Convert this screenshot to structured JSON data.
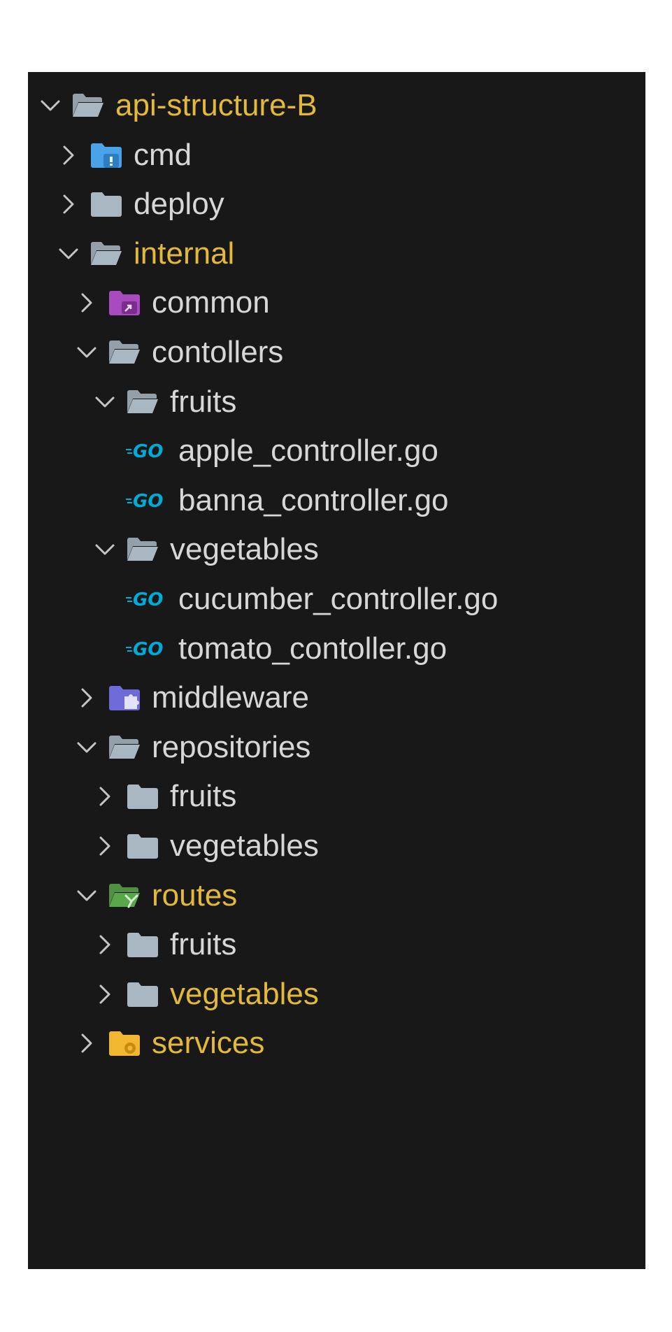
{
  "explorer": {
    "items": [
      {
        "label": "api-structure-B",
        "kind": "folder-open",
        "depth": 0,
        "expanded": true,
        "modified": true,
        "icon": "folder-open-icon"
      },
      {
        "label": "cmd",
        "kind": "folder",
        "depth": 1,
        "expanded": false,
        "modified": false,
        "icon": "folder-cmd-icon"
      },
      {
        "label": "deploy",
        "kind": "folder",
        "depth": 1,
        "expanded": false,
        "modified": false,
        "icon": "folder-icon"
      },
      {
        "label": "internal",
        "kind": "folder-open",
        "depth": 1,
        "expanded": true,
        "modified": true,
        "icon": "folder-open-icon"
      },
      {
        "label": "common",
        "kind": "folder",
        "depth": 2,
        "expanded": false,
        "modified": false,
        "icon": "folder-common-icon"
      },
      {
        "label": "contollers",
        "kind": "folder-open",
        "depth": 2,
        "expanded": true,
        "modified": false,
        "icon": "folder-open-icon"
      },
      {
        "label": "fruits",
        "kind": "folder-open",
        "depth": 3,
        "expanded": true,
        "modified": false,
        "icon": "folder-open-icon"
      },
      {
        "label": "apple_controller.go",
        "kind": "file-go",
        "depth": 4,
        "modified": false,
        "icon": "go-file-icon"
      },
      {
        "label": "banna_controller.go",
        "kind": "file-go",
        "depth": 4,
        "modified": false,
        "icon": "go-file-icon"
      },
      {
        "label": "vegetables",
        "kind": "folder-open",
        "depth": 3,
        "expanded": true,
        "modified": false,
        "icon": "folder-open-icon"
      },
      {
        "label": "cucumber_controller.go",
        "kind": "file-go",
        "depth": 4,
        "modified": false,
        "icon": "go-file-icon"
      },
      {
        "label": "tomato_contoller.go",
        "kind": "file-go",
        "depth": 4,
        "modified": false,
        "icon": "go-file-icon"
      },
      {
        "label": "middleware",
        "kind": "folder",
        "depth": 2,
        "expanded": false,
        "modified": false,
        "icon": "folder-middleware-icon"
      },
      {
        "label": "repositories",
        "kind": "folder-open",
        "depth": 2,
        "expanded": true,
        "modified": false,
        "icon": "folder-open-icon"
      },
      {
        "label": "fruits",
        "kind": "folder",
        "depth": 3,
        "expanded": false,
        "modified": false,
        "icon": "folder-icon"
      },
      {
        "label": "vegetables",
        "kind": "folder",
        "depth": 3,
        "expanded": false,
        "modified": false,
        "icon": "folder-icon"
      },
      {
        "label": "routes",
        "kind": "folder-open",
        "depth": 2,
        "expanded": true,
        "modified": true,
        "icon": "folder-routes-icon"
      },
      {
        "label": "fruits",
        "kind": "folder",
        "depth": 3,
        "expanded": false,
        "modified": false,
        "icon": "folder-icon"
      },
      {
        "label": "vegetables",
        "kind": "folder",
        "depth": 3,
        "expanded": false,
        "modified": true,
        "icon": "folder-icon"
      },
      {
        "label": "services",
        "kind": "folder",
        "depth": 2,
        "expanded": false,
        "modified": true,
        "icon": "folder-services-icon"
      }
    ],
    "go_badge": "GO"
  },
  "colors": {
    "panel_bg": "#181818",
    "text": "#d7d7d7",
    "modified_text": "#e3b93b",
    "folder_gray": "#a9b7c3",
    "cmd_blue": "#4aa3e8",
    "common_purple": "#a84bbf",
    "middleware_indigo": "#6e6ad8",
    "routes_green": "#5aa64a",
    "services_yellow": "#f2b731",
    "go_cyan": "#00acd7"
  }
}
